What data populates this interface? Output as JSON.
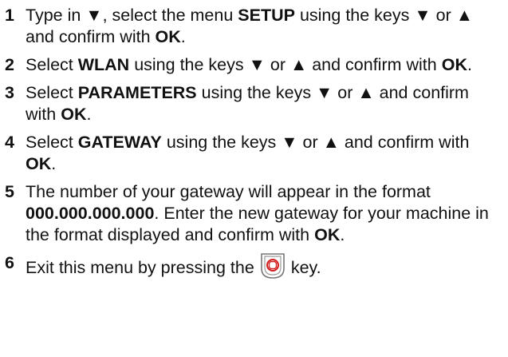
{
  "steps": [
    {
      "num": "1",
      "parts": [
        "Type in ▼, select the menu ",
        "SETUP",
        " using the keys ▼ or ▲ and confirm with ",
        "OK",
        "."
      ]
    },
    {
      "num": "2",
      "parts": [
        "Select ",
        "WLAN",
        " using the keys ▼ or ▲ and confirm with ",
        "OK",
        "."
      ]
    },
    {
      "num": "3",
      "parts": [
        "Select ",
        "PARAMETERS",
        " using the keys ▼ or ▲ and confirm with ",
        "OK",
        "."
      ]
    },
    {
      "num": "4",
      "parts": [
        "Select ",
        "GATEWAY",
        " using the keys ▼ or ▲ and confirm with ",
        "OK",
        "."
      ]
    },
    {
      "num": "5",
      "parts": [
        "The number of your gateway will appear in the format ",
        "000.000.000.000",
        ". Enter the new gateway for your machine in the format displayed and confirm with ",
        "OK",
        "."
      ]
    },
    {
      "num": "6",
      "before": "Exit this menu by pressing the",
      "after": "key.",
      "key_icon": "stop-key-icon"
    }
  ]
}
